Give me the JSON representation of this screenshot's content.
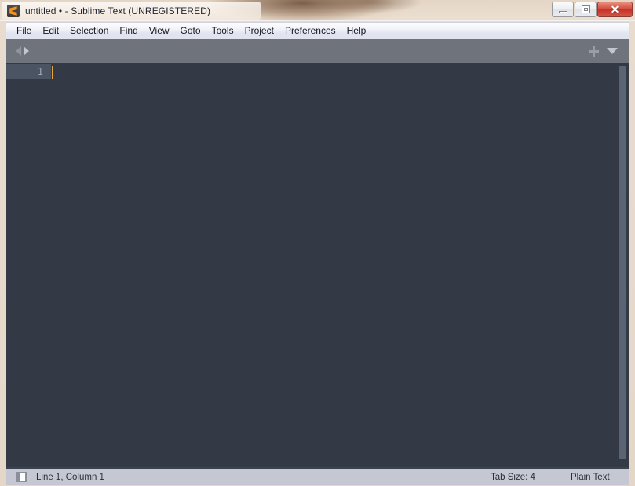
{
  "window": {
    "title": "untitled • - Sublime Text (UNREGISTERED)",
    "app_icon_name": "sublime-text-logo",
    "controls": {
      "minimize_label": "",
      "maximize_label": "",
      "close_label": "✕"
    },
    "colors": {
      "frame": "#e5d7c8",
      "menubar": "#e2e5f1",
      "tabbar": "#6e737c",
      "editor_bg": "#333a45",
      "gutter_active": "#4a5463",
      "caret": "#e8a33d",
      "statusbar": "#c5c8d2",
      "scrollbar": "#5a6472",
      "close_button": "#c23326"
    }
  },
  "menubar": {
    "items": [
      {
        "label": "File"
      },
      {
        "label": "Edit"
      },
      {
        "label": "Selection"
      },
      {
        "label": "Find"
      },
      {
        "label": "View"
      },
      {
        "label": "Goto"
      },
      {
        "label": "Tools"
      },
      {
        "label": "Project"
      },
      {
        "label": "Preferences"
      },
      {
        "label": "Help"
      }
    ]
  },
  "tabbar": {
    "nav_prev_icon": "triangle-left-icon",
    "nav_next_icon": "triangle-right-icon",
    "new_tab_icon": "plus-icon",
    "tab_menu_icon": "caret-down-icon",
    "tabs": []
  },
  "editor": {
    "line_numbers": [
      "1"
    ],
    "content": "",
    "caret_line": 1,
    "caret_column": 1
  },
  "statusbar": {
    "sidebar_toggle_icon": "sidebar-panel-icon",
    "position": "Line 1, Column 1",
    "tab_size": "Tab Size: 4",
    "syntax": "Plain Text"
  }
}
